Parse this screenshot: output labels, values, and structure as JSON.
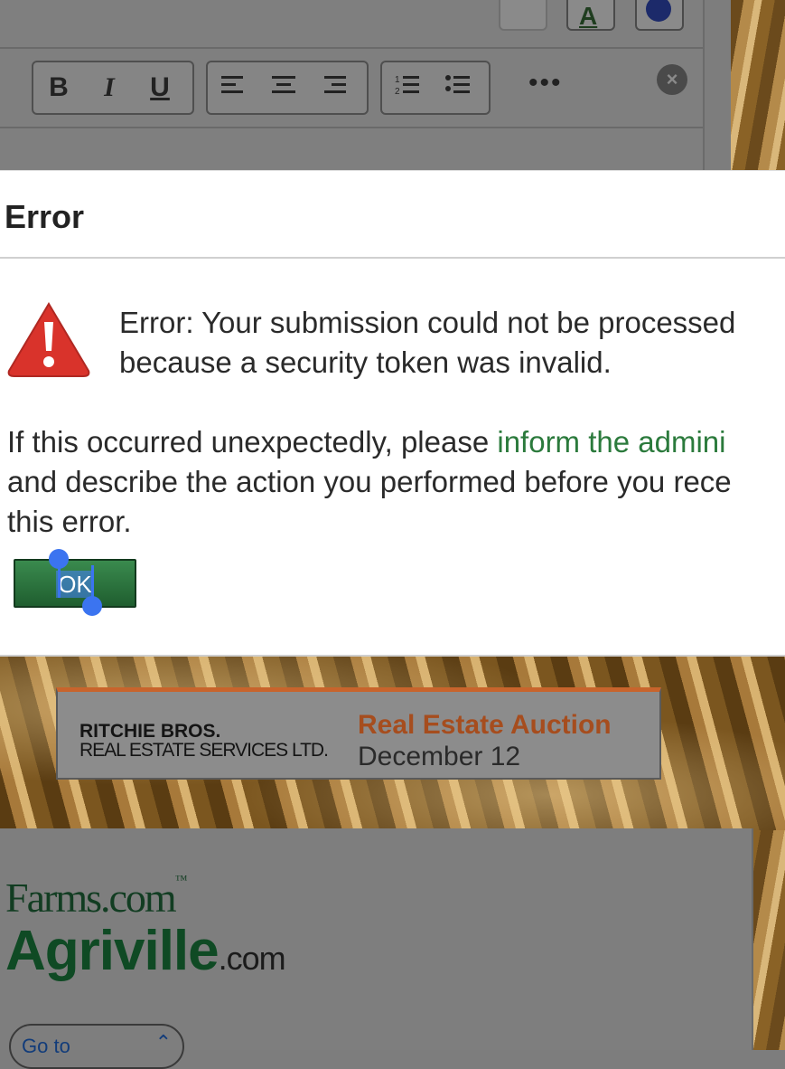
{
  "editor": {
    "toolbar": {
      "bold": "B",
      "italic": "I",
      "underline": "U",
      "more": "•••"
    }
  },
  "dialog": {
    "title": "Error",
    "message_line1": "Error: Your submission could not be processed",
    "message_line2": "because a security token was invalid.",
    "help_prefix": "If this occurred unexpectedly, please ",
    "help_link": "inform the admini",
    "help_line2": "and describe the action you performed before you rece",
    "help_line3": "this error.",
    "ok_label": "OK"
  },
  "ad": {
    "company": "RITCHIE BROS.",
    "company_sub": "REAL ESTATE SERVICES LTD.",
    "headline": "Real Estate Auction",
    "date": "December 12"
  },
  "site": {
    "farms_logo": "Farms.com",
    "farms_tm": "™",
    "agriville": "Agriville",
    "agriville_tld": ".com",
    "goto_label": "Go to"
  },
  "colors": {
    "ok_button": "#2a7340",
    "link": "#2b7a3c",
    "warning": "#d9332b",
    "auction_orange": "#a64d1e"
  }
}
